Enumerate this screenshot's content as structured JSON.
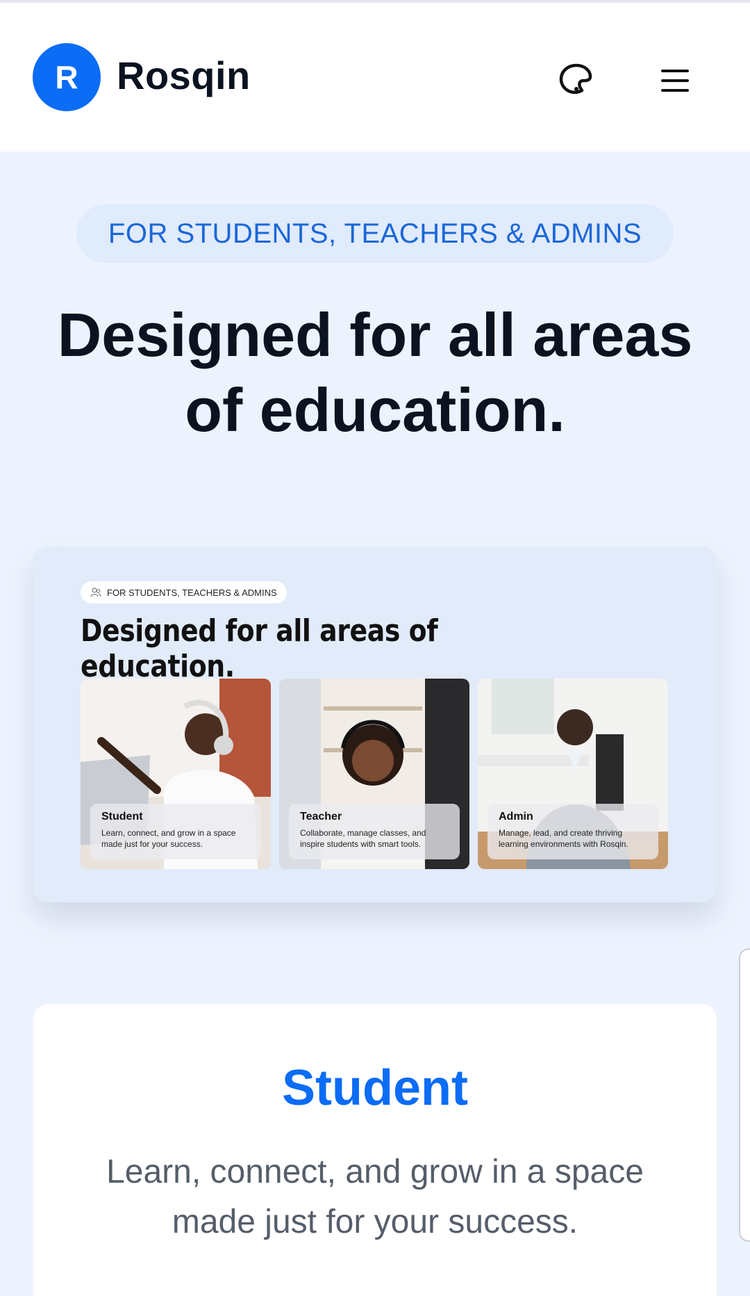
{
  "header": {
    "logo_letter": "R",
    "brand": "Rosqin",
    "theme_icon": "palette-icon",
    "menu_icon": "hamburger-menu-icon"
  },
  "hero": {
    "pill": "FOR STUDENTS, TEACHERS & ADMINS",
    "title_line1": "Designed for all areas",
    "title_line2": "of education."
  },
  "preview": {
    "pill_icon": "users-icon",
    "pill": "FOR STUDENTS, TEACHERS & ADMINS",
    "title": "Designed for all areas of education.",
    "cards": [
      {
        "name": "Student",
        "desc": "Learn, connect, and grow in a space made just for your success."
      },
      {
        "name": "Teacher",
        "desc": "Collaborate, manage classes, and inspire students with smart tools."
      },
      {
        "name": "Admin",
        "desc": "Manage, lead, and create thriving learning environments with Rosqin."
      }
    ]
  },
  "student_section": {
    "title": "Student",
    "desc": "Learn, connect, and grow in a space made just for your success."
  },
  "colors": {
    "accent": "#0b6cf5",
    "page_bg": "#edf3fe",
    "pill_text": "#1a67d8"
  }
}
